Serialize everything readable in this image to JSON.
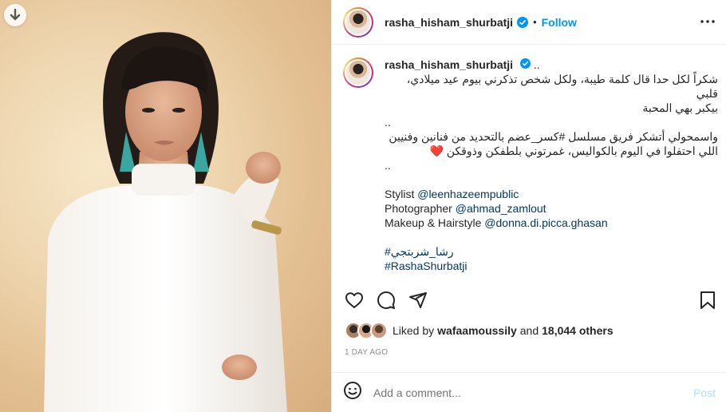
{
  "post": {
    "username": "rasha_hisham_shurbatji",
    "dot": "•",
    "follow_label": "Follow"
  },
  "caption": {
    "username": "rasha_hisham_shurbatji",
    "trail": "..",
    "lines": [
      "شكراً لكل حدا قال كلمة طيبة، ولكل شخص تذكرني بيوم عيد ميلادي، قلبي",
      "بيكبر بهي المحبة",
      "..",
      "واسمحولي أتشكر فريق مسلسل #كسر_عضم بالتحديد من فنانين وفنيين",
      "اللي احتفلوا في اليوم بالكواليس، غمرتوني بلطفكن وذوقكن ❤️",
      ".."
    ],
    "stylist_label": "Stylist",
    "stylist_handle": "@leenhazeempublic",
    "photographer_label": "Photographer",
    "photographer_handle": "@ahmad_zamlout",
    "makeup_label": "Makeup & Hairstyle",
    "makeup_handle": "@donna.di.picca.ghasan",
    "hashtag_ar": "#رشا_شربتجي",
    "hashtag_en": "#RashaShurbatji"
  },
  "likes": {
    "prefix": "Liked by",
    "liker": "wafaamoussily",
    "connector": "and",
    "others": "18,044 others"
  },
  "time_label": "1 DAY AGO",
  "comment": {
    "placeholder": "Add a comment...",
    "post_label": "Post"
  },
  "colors": {
    "accent": "#0095f6",
    "link": "#00376b",
    "muted": "#8e8e8e",
    "heart": "#ed4956"
  }
}
